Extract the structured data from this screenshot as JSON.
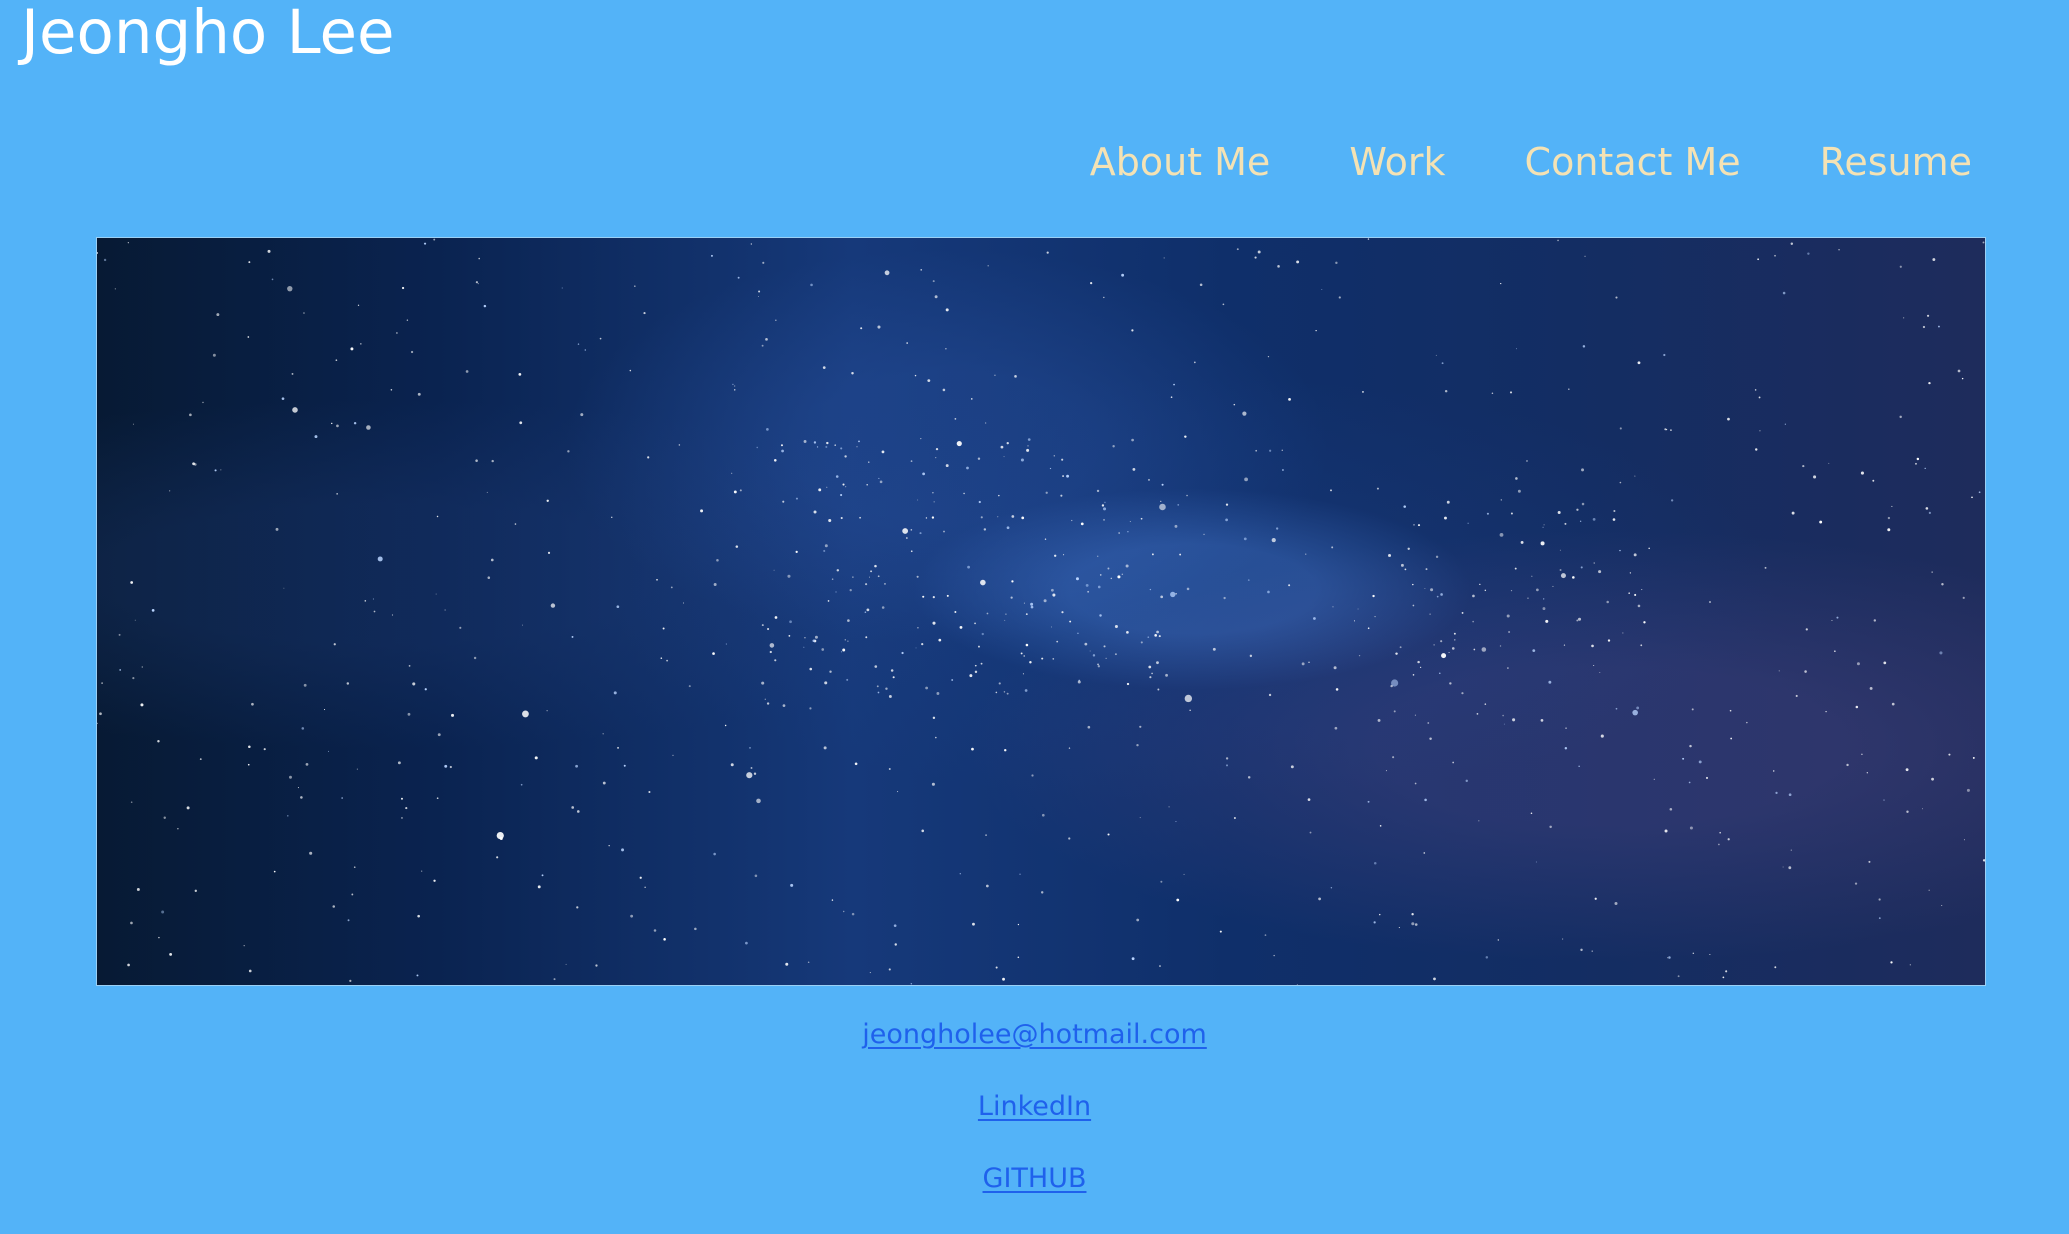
{
  "header": {
    "site_title": "Jeongho Lee"
  },
  "nav": {
    "items": [
      {
        "label": "About Me"
      },
      {
        "label": "Work"
      },
      {
        "label": "Contact Me"
      },
      {
        "label": "Resume"
      }
    ]
  },
  "hero": {
    "image_subject": "starry night sky"
  },
  "contact": {
    "email": "jeongholee@hotmail.com",
    "linkedin": "LinkedIn",
    "github": "GITHUB"
  },
  "colors": {
    "background": "#53b3f8",
    "title": "#ffffff",
    "nav_text": "#f4e2b4",
    "link": "#1f61ec"
  },
  "icons": []
}
